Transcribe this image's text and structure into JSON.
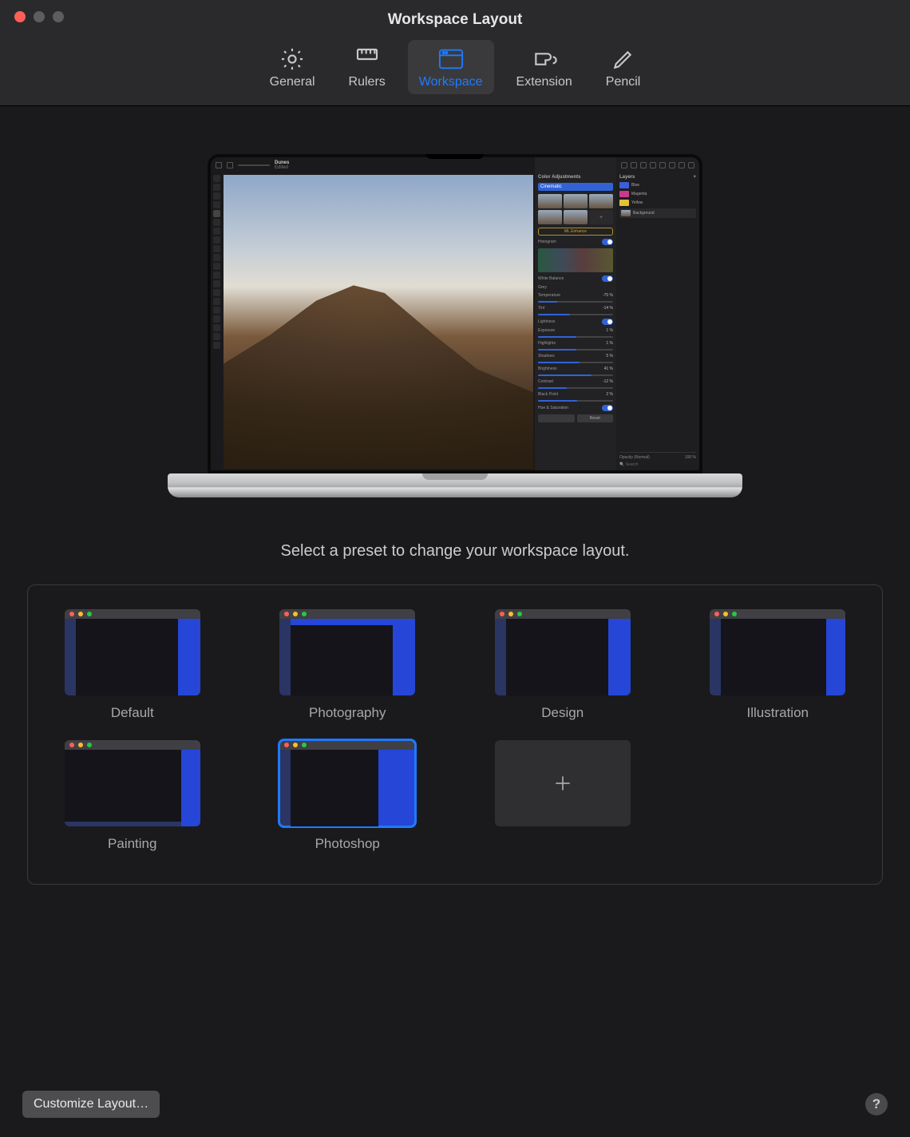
{
  "window": {
    "title": "Workspace Layout"
  },
  "toolbar": {
    "tabs": [
      {
        "id": "general",
        "label": "General"
      },
      {
        "id": "rulers",
        "label": "Rulers"
      },
      {
        "id": "workspace",
        "label": "Workspace",
        "active": true
      },
      {
        "id": "extension",
        "label": "Extension"
      },
      {
        "id": "pencil",
        "label": "Pencil"
      }
    ]
  },
  "preview_app": {
    "doc_title": "Dunes",
    "doc_status": "Edited",
    "panels": {
      "color_adjustments": {
        "title": "Color Adjustments",
        "preset": "Cinematic",
        "ml_button": "ML Enhance",
        "histogram_label": "Histogram",
        "sections": [
          {
            "name": "White Balance",
            "icon": "reset"
          },
          {
            "name": "Grey"
          },
          {
            "name": "Temperature",
            "value": "-75 %"
          },
          {
            "name": "Tint",
            "value": "-14 %"
          },
          {
            "name": "Lightness",
            "icon": "reset-ml"
          },
          {
            "name": "Exposure",
            "value": "1 %"
          },
          {
            "name": "Highlights",
            "value": "1 %"
          },
          {
            "name": "Shadows",
            "value": "5 %"
          },
          {
            "name": "Brightness",
            "value": "41 %"
          },
          {
            "name": "Contrast",
            "value": "-12 %"
          },
          {
            "name": "Black Point",
            "value": "2 %"
          },
          {
            "name": "Hue & Saturation",
            "icon": "reset"
          }
        ],
        "reset_btn": "Reset"
      },
      "layers": {
        "title": "Layers",
        "items": [
          {
            "name": "Blue",
            "color": "#3a5fd8"
          },
          {
            "name": "Magenta",
            "color": "#c93a8a"
          },
          {
            "name": "Yellow",
            "color": "#e2c23a"
          },
          {
            "name": "Background",
            "thumb": true
          }
        ],
        "opacity_label": "Opacity (Normal)",
        "opacity_value": "100 %",
        "search_placeholder": "Search"
      }
    }
  },
  "prompt": "Select a preset to change your workspace layout.",
  "presets": [
    {
      "id": "default",
      "label": "Default",
      "layout": {
        "l": 14,
        "r": 28
      }
    },
    {
      "id": "photography",
      "label": "Photography",
      "layout": {
        "top": true,
        "l": 14,
        "r": 28
      }
    },
    {
      "id": "design",
      "label": "Design",
      "layout": {
        "l": 14,
        "r": 28
      }
    },
    {
      "id": "illustration",
      "label": "Illustration",
      "layout": {
        "l": 14,
        "r": 24
      }
    },
    {
      "id": "painting",
      "label": "Painting",
      "layout": {
        "bottom": true,
        "l": 0,
        "r": 24
      }
    },
    {
      "id": "photoshop",
      "label": "Photoshop",
      "layout": {
        "l": 14,
        "r": 46,
        "selected": true
      }
    }
  ],
  "footer": {
    "customize": "Customize Layout…",
    "help": "?"
  }
}
